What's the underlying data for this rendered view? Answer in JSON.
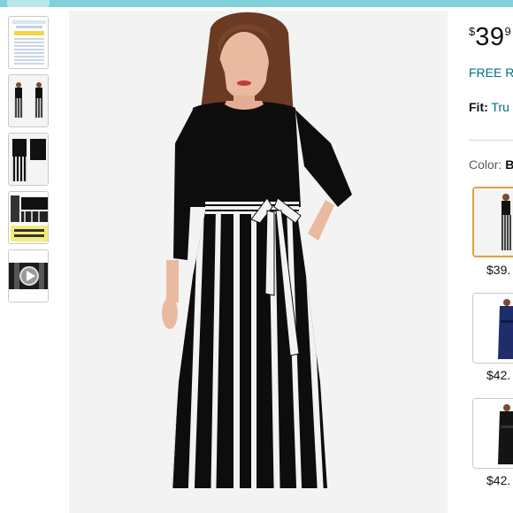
{
  "browser": {
    "top_accent_color": "#7fd0d8"
  },
  "gallery": {
    "thumbnails": [
      {
        "name": "size-chart-thumbnail"
      },
      {
        "name": "dress-front-back-thumbnail"
      },
      {
        "name": "dress-flat-lay-thumbnail"
      },
      {
        "name": "fabric-detail-thumbnail"
      },
      {
        "name": "video-thumbnail",
        "icon": "play-icon"
      }
    ],
    "main_image": {
      "background": "#f3f3f3"
    }
  },
  "buybox": {
    "price": {
      "symbol": "$",
      "whole": "39",
      "fraction": "9"
    },
    "free_returns": "FREE R",
    "fit": {
      "label": "Fit:",
      "value": "Tru"
    },
    "color": {
      "label": "Color:",
      "value": "B"
    },
    "swatches": [
      {
        "price": "$39.",
        "selected": true,
        "variant": "black-white-stripe"
      },
      {
        "price": "$42.",
        "selected": false,
        "variant": "navy"
      },
      {
        "price": "$42.",
        "selected": false,
        "variant": "black"
      }
    ],
    "link_color": "#007185",
    "selected_border_color": "#e2a03f"
  }
}
